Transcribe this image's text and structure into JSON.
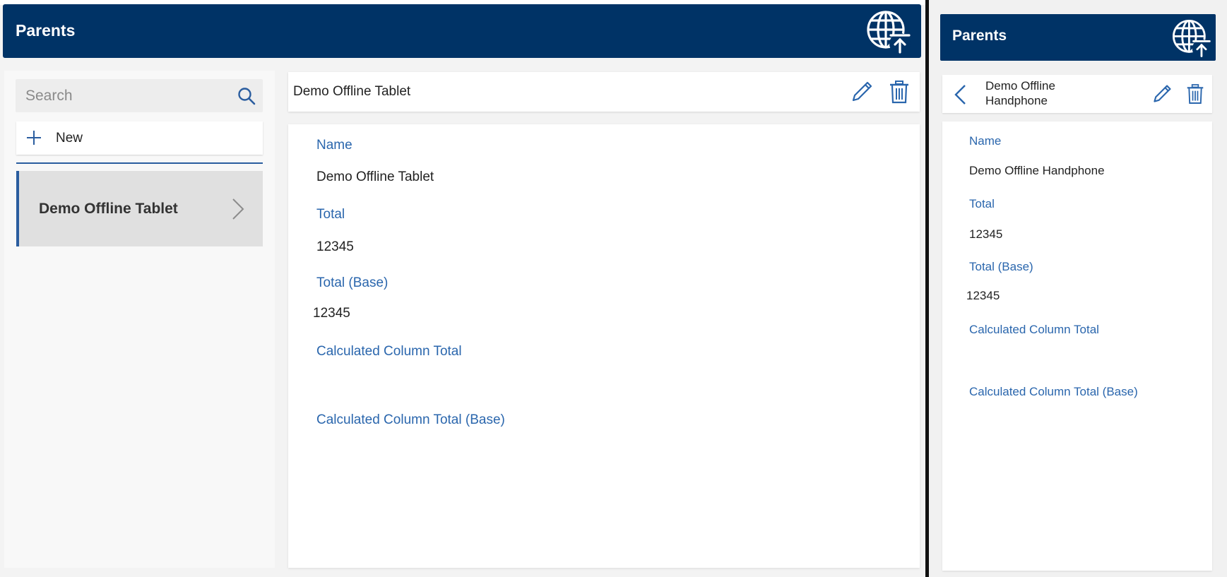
{
  "colors": {
    "header_bg": "#003366",
    "accent": "#2a5d9f",
    "field_label": "#2a66ad"
  },
  "tablet": {
    "header": {
      "title": "Parents",
      "sync_icon": "globe-upload-icon"
    },
    "search": {
      "placeholder": "Search",
      "value": ""
    },
    "new_button": {
      "label": "New"
    },
    "list": [
      {
        "label": "Demo Offline Tablet",
        "selected": true
      }
    ],
    "detail": {
      "title": "Demo Offline Tablet",
      "fields": [
        {
          "label": "Name",
          "value": "Demo Offline Tablet"
        },
        {
          "label": "Total",
          "value": "12345"
        },
        {
          "label": "Total (Base)",
          "value": "12345"
        },
        {
          "label": "Calculated Column Total",
          "value": ""
        },
        {
          "label": "Calculated Column Total (Base)",
          "value": ""
        }
      ]
    }
  },
  "phone": {
    "header": {
      "title": "Parents",
      "sync_icon": "globe-upload-icon"
    },
    "detail": {
      "title": "Demo Offline Handphone",
      "fields": [
        {
          "label": "Name",
          "value": "Demo Offline Handphone"
        },
        {
          "label": "Total",
          "value": "12345"
        },
        {
          "label": "Total (Base)",
          "value": "12345"
        },
        {
          "label": "Calculated Column Total",
          "value": ""
        },
        {
          "label": "Calculated Column Total (Base)",
          "value": ""
        }
      ]
    }
  }
}
